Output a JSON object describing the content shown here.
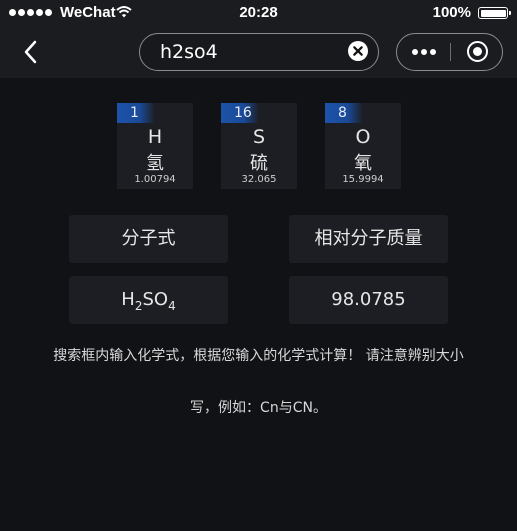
{
  "status_bar": {
    "carrier": "WeChat",
    "time": "20:28",
    "battery": "100%"
  },
  "nav": {
    "search": {
      "value": "h2so4"
    }
  },
  "elements": [
    {
      "number": "1",
      "symbol": "H",
      "name": "氢",
      "mass": "1.00794"
    },
    {
      "number": "16",
      "symbol": "S",
      "name": "硫",
      "mass": "32.065"
    },
    {
      "number": "8",
      "symbol": "O",
      "name": "氧",
      "mass": "15.9994"
    }
  ],
  "result": {
    "formula_label": "分子式",
    "mass_label": "相对分子质量",
    "formula": {
      "H": "H",
      "H_count": "2",
      "S": "SO",
      "O_count": "4"
    },
    "mass_value": "98.0785"
  },
  "hint": {
    "line1": "搜索框内输入化学式，根据您输入的化学式计算！ 请注意辨别大小",
    "line2": "写，例如：Cn与CN。"
  },
  "colors": {
    "background": "#111216",
    "card": "#1d1e23",
    "accent": "#1c53a8"
  }
}
